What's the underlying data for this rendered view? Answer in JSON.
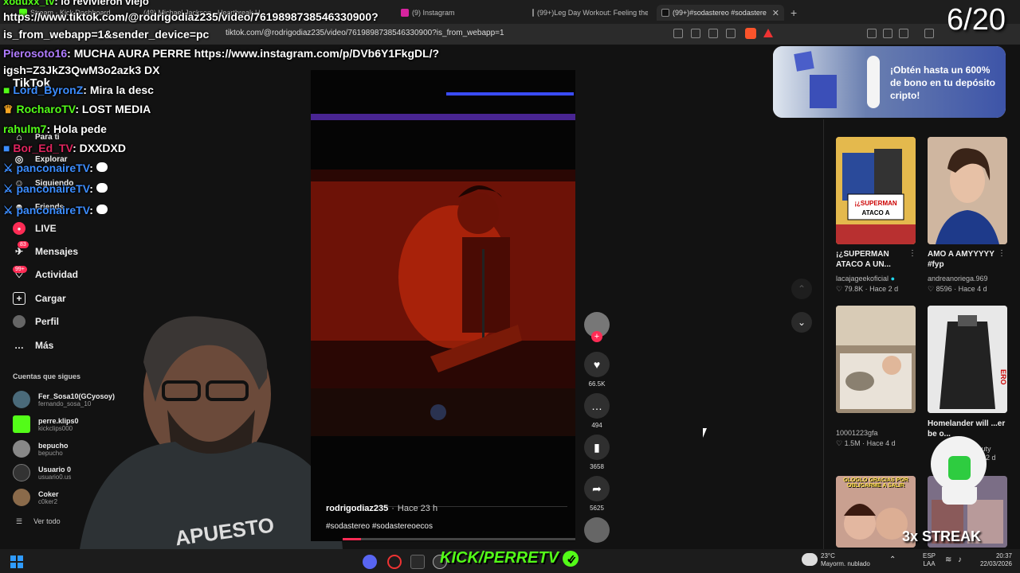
{
  "browser": {
    "tabs": [
      {
        "label": "Stream - Kick Dashboard"
      },
      {
        "label": "(49) Michael Jackson - Heartbreak H..."
      },
      {
        "label": "(9) Instagram"
      },
      {
        "label": "(99+)Leg Day Workout: Feeling the B..."
      },
      {
        "label": "(99+)#sodastereo #sodastere"
      }
    ],
    "url": "tiktok.com/@rodrigodiaz235/video/7619898738546330900?is_from_webapp=1"
  },
  "tiktok": {
    "logo": "TikTok",
    "nav": [
      {
        "label": "Para ti",
        "icon": "home-icon"
      },
      {
        "label": "Explorar",
        "icon": "compass-icon"
      },
      {
        "label": "Siguiendo",
        "icon": "following-icon"
      },
      {
        "label": "Friends",
        "icon": "friends-icon"
      },
      {
        "label": "LIVE",
        "icon": "live-icon"
      },
      {
        "label": "Mensajes",
        "icon": "messages-icon",
        "badge": "83"
      },
      {
        "label": "Actividad",
        "icon": "activity-icon",
        "badge": "99+"
      },
      {
        "label": "Cargar",
        "icon": "upload-icon"
      },
      {
        "label": "Perfil",
        "icon": "profile-icon"
      },
      {
        "label": "Más",
        "icon": "more-icon"
      }
    ],
    "following_title": "Cuentas que sigues",
    "following": [
      {
        "name": "Fer_Sosa10(GCyosoy)",
        "handle": "fernando_sosa_10"
      },
      {
        "name": "perre.klips0",
        "handle": "kickclips000"
      },
      {
        "name": "bepucho",
        "handle": "bepucho"
      },
      {
        "name": "Usuario 0",
        "handle": "usuario0.us"
      },
      {
        "name": "Coker",
        "handle": "c0ker2"
      }
    ],
    "see_all": "Ver todo",
    "video": {
      "author": "rodrigodiaz235",
      "time": "Hace 23 h",
      "caption": "#sodastereo #sodastereoecos",
      "likes": "66.5K",
      "comments": "494",
      "saves": "3658",
      "shares": "5625"
    },
    "ad": {
      "text": "¡Obtén hasta un 600% de bono en tu depósito cripto!"
    },
    "suggestions": [
      {
        "caption": "¡¿SUPERMAN ATACO A UN...",
        "user": "lacajageekoficial",
        "likes": "79.8K",
        "time": "Hace 2 d",
        "thumb_text": "¡¿SUPERMAN ATACO A UN NIÑO?!"
      },
      {
        "caption": "AMO A AMYYYYY #fyp",
        "user": "andreanoriega.969",
        "likes": "8596",
        "time": "Hace 4 d"
      },
      {
        "caption": "",
        "user": "10001223gfa",
        "likes": "1.5M",
        "time": "Hace 4 d"
      },
      {
        "caption": "Homelander will ...er be o...",
        "user": "...nauty",
        "likes": "",
        "time": "2 d"
      }
    ],
    "bottom_thumb_text": "GLOGLO GRACIAS POR OBLIGARME A SALIR"
  },
  "overlay": {
    "top_chat": [
      {
        "user": "xoduxx_tv",
        "text": "lo revivieron viejo"
      }
    ],
    "chat_lines": [
      {
        "user": "",
        "text": "https://www.tiktok.com/@rodrigodiaz235/video/7619898738546330900?"
      },
      {
        "user": "",
        "text": "is_from_webapp=1&sender_device=pc"
      },
      {
        "user": "Pierosoto16",
        "text": "MUCHA AURA PERRE https://www.instagram.com/p/DVb6Y1FkgDL/?"
      },
      {
        "user": "",
        "text": "igsh=Z3JkZ3QwM3o2azk3 DX"
      },
      {
        "user": "Lord_ByronZ",
        "text": "Mira la desc"
      },
      {
        "user": "RocharoTV",
        "text": "LOST MEDIA"
      },
      {
        "user": "rahulm7",
        "text": "Hola pede"
      },
      {
        "user": "Bor_Ed_TV",
        "text": "DXXDXD"
      },
      {
        "user": "panconaireTV",
        "text": ""
      },
      {
        "user": "panconaireTV",
        "text": ""
      },
      {
        "user": "panconaireTV",
        "text": ""
      }
    ],
    "counter": "6/20",
    "streak": "3x STREAK",
    "kick_brand": "KICK/PERRETV"
  },
  "taskbar": {
    "weather_temp": "23°C",
    "weather_desc": "Mayorm. nublado",
    "lang": "ESP",
    "lang2": "LAA",
    "time": "20:37",
    "date": "22/03/2026"
  },
  "colors": {
    "kick_green": "#53fc18",
    "tiktok_red": "#fe2c55",
    "chat_green": "#53fc18",
    "chat_blue": "#3c8dff"
  }
}
